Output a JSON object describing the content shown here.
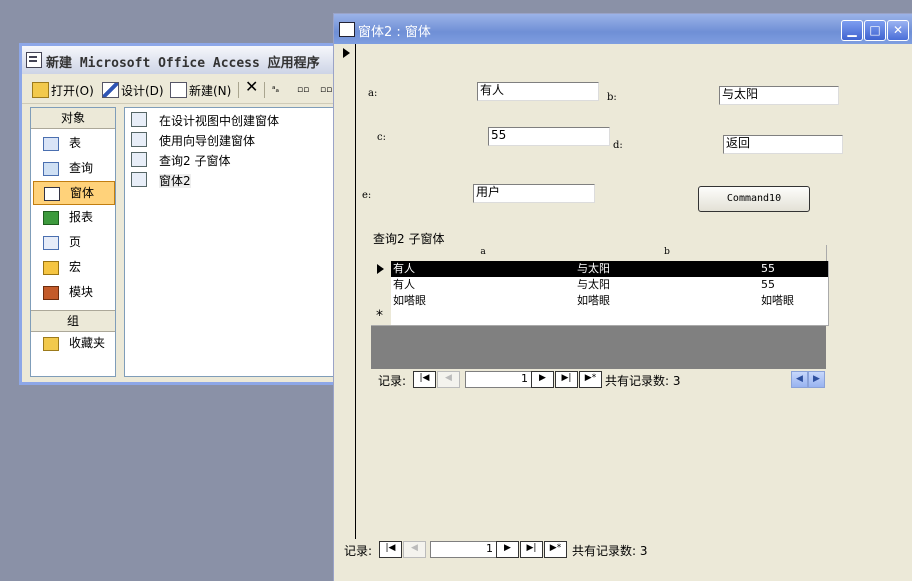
{
  "topbar": {},
  "db_window": {
    "title": "新建 Microsoft Office Access 应用程序",
    "toolbar": {
      "open": "打开(O)",
      "design": "设计(D)",
      "new": "新建(N)"
    },
    "objects_header": "对象",
    "objects": [
      {
        "label": "表",
        "icon": "table-icon"
      },
      {
        "label": "查询",
        "icon": "query-icon"
      },
      {
        "label": "窗体",
        "icon": "form-icon",
        "selected": true
      },
      {
        "label": "报表",
        "icon": "report-icon"
      },
      {
        "label": "页",
        "icon": "page-icon"
      },
      {
        "label": "宏",
        "icon": "macro-icon"
      },
      {
        "label": "模块",
        "icon": "module-icon"
      }
    ],
    "groups_header": "组",
    "favorites": "收藏夹",
    "list_items": [
      "在设计视图中创建窗体",
      "使用向导创建窗体",
      "查询2 子窗体",
      "窗体2"
    ]
  },
  "form_window": {
    "title": "窗体2 : 窗体",
    "fields": {
      "a_label": "a:",
      "a_value": "有人",
      "b_label": "b:",
      "b_value": "与太阳",
      "c_label": "c:",
      "c_value": "55",
      "d_label": "d:",
      "d_value": "返回",
      "e_label": "e:",
      "e_value": "用户"
    },
    "command_button": "Command10",
    "subform": {
      "caption": "查询2 子窗体",
      "columns": [
        "a",
        "b",
        ""
      ],
      "rows": [
        [
          "有人",
          "与太阳",
          "55"
        ],
        [
          "有人",
          "与太阳",
          "55"
        ],
        [
          "如嗒眼",
          "如嗒眼",
          "如嗒眼"
        ]
      ],
      "nav": {
        "label": "记录:",
        "current": "1",
        "total_text": "共有记录数: 3"
      }
    },
    "nav": {
      "label": "记录:",
      "current": "1",
      "total_text": "共有记录数: 3"
    }
  },
  "colors": {
    "desktop": "#8a91a7",
    "titlebar_active": "#6f8fd6",
    "selected_object": "#ffd27a"
  }
}
